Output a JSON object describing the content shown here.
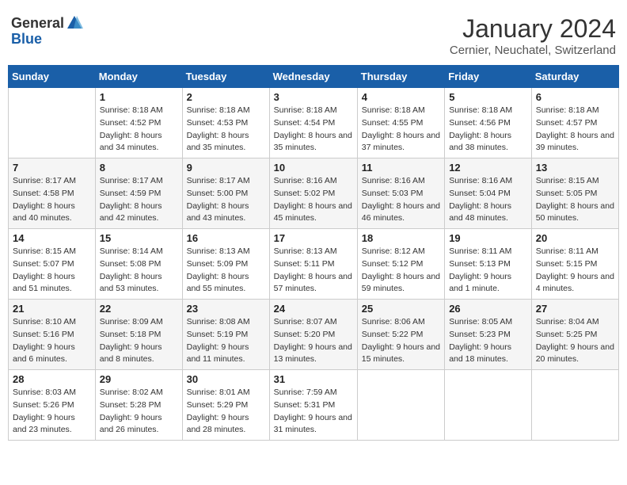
{
  "logo": {
    "general": "General",
    "blue": "Blue"
  },
  "title": "January 2024",
  "location": "Cernier, Neuchatel, Switzerland",
  "header": {
    "days": [
      "Sunday",
      "Monday",
      "Tuesday",
      "Wednesday",
      "Thursday",
      "Friday",
      "Saturday"
    ]
  },
  "weeks": [
    [
      {
        "day": "",
        "sunrise": "",
        "sunset": "",
        "daylight": ""
      },
      {
        "day": "1",
        "sunrise": "Sunrise: 8:18 AM",
        "sunset": "Sunset: 4:52 PM",
        "daylight": "Daylight: 8 hours and 34 minutes."
      },
      {
        "day": "2",
        "sunrise": "Sunrise: 8:18 AM",
        "sunset": "Sunset: 4:53 PM",
        "daylight": "Daylight: 8 hours and 35 minutes."
      },
      {
        "day": "3",
        "sunrise": "Sunrise: 8:18 AM",
        "sunset": "Sunset: 4:54 PM",
        "daylight": "Daylight: 8 hours and 35 minutes."
      },
      {
        "day": "4",
        "sunrise": "Sunrise: 8:18 AM",
        "sunset": "Sunset: 4:55 PM",
        "daylight": "Daylight: 8 hours and 37 minutes."
      },
      {
        "day": "5",
        "sunrise": "Sunrise: 8:18 AM",
        "sunset": "Sunset: 4:56 PM",
        "daylight": "Daylight: 8 hours and 38 minutes."
      },
      {
        "day": "6",
        "sunrise": "Sunrise: 8:18 AM",
        "sunset": "Sunset: 4:57 PM",
        "daylight": "Daylight: 8 hours and 39 minutes."
      }
    ],
    [
      {
        "day": "7",
        "sunrise": "Sunrise: 8:17 AM",
        "sunset": "Sunset: 4:58 PM",
        "daylight": "Daylight: 8 hours and 40 minutes."
      },
      {
        "day": "8",
        "sunrise": "Sunrise: 8:17 AM",
        "sunset": "Sunset: 4:59 PM",
        "daylight": "Daylight: 8 hours and 42 minutes."
      },
      {
        "day": "9",
        "sunrise": "Sunrise: 8:17 AM",
        "sunset": "Sunset: 5:00 PM",
        "daylight": "Daylight: 8 hours and 43 minutes."
      },
      {
        "day": "10",
        "sunrise": "Sunrise: 8:16 AM",
        "sunset": "Sunset: 5:02 PM",
        "daylight": "Daylight: 8 hours and 45 minutes."
      },
      {
        "day": "11",
        "sunrise": "Sunrise: 8:16 AM",
        "sunset": "Sunset: 5:03 PM",
        "daylight": "Daylight: 8 hours and 46 minutes."
      },
      {
        "day": "12",
        "sunrise": "Sunrise: 8:16 AM",
        "sunset": "Sunset: 5:04 PM",
        "daylight": "Daylight: 8 hours and 48 minutes."
      },
      {
        "day": "13",
        "sunrise": "Sunrise: 8:15 AM",
        "sunset": "Sunset: 5:05 PM",
        "daylight": "Daylight: 8 hours and 50 minutes."
      }
    ],
    [
      {
        "day": "14",
        "sunrise": "Sunrise: 8:15 AM",
        "sunset": "Sunset: 5:07 PM",
        "daylight": "Daylight: 8 hours and 51 minutes."
      },
      {
        "day": "15",
        "sunrise": "Sunrise: 8:14 AM",
        "sunset": "Sunset: 5:08 PM",
        "daylight": "Daylight: 8 hours and 53 minutes."
      },
      {
        "day": "16",
        "sunrise": "Sunrise: 8:13 AM",
        "sunset": "Sunset: 5:09 PM",
        "daylight": "Daylight: 8 hours and 55 minutes."
      },
      {
        "day": "17",
        "sunrise": "Sunrise: 8:13 AM",
        "sunset": "Sunset: 5:11 PM",
        "daylight": "Daylight: 8 hours and 57 minutes."
      },
      {
        "day": "18",
        "sunrise": "Sunrise: 8:12 AM",
        "sunset": "Sunset: 5:12 PM",
        "daylight": "Daylight: 8 hours and 59 minutes."
      },
      {
        "day": "19",
        "sunrise": "Sunrise: 8:11 AM",
        "sunset": "Sunset: 5:13 PM",
        "daylight": "Daylight: 9 hours and 1 minute."
      },
      {
        "day": "20",
        "sunrise": "Sunrise: 8:11 AM",
        "sunset": "Sunset: 5:15 PM",
        "daylight": "Daylight: 9 hours and 4 minutes."
      }
    ],
    [
      {
        "day": "21",
        "sunrise": "Sunrise: 8:10 AM",
        "sunset": "Sunset: 5:16 PM",
        "daylight": "Daylight: 9 hours and 6 minutes."
      },
      {
        "day": "22",
        "sunrise": "Sunrise: 8:09 AM",
        "sunset": "Sunset: 5:18 PM",
        "daylight": "Daylight: 9 hours and 8 minutes."
      },
      {
        "day": "23",
        "sunrise": "Sunrise: 8:08 AM",
        "sunset": "Sunset: 5:19 PM",
        "daylight": "Daylight: 9 hours and 11 minutes."
      },
      {
        "day": "24",
        "sunrise": "Sunrise: 8:07 AM",
        "sunset": "Sunset: 5:20 PM",
        "daylight": "Daylight: 9 hours and 13 minutes."
      },
      {
        "day": "25",
        "sunrise": "Sunrise: 8:06 AM",
        "sunset": "Sunset: 5:22 PM",
        "daylight": "Daylight: 9 hours and 15 minutes."
      },
      {
        "day": "26",
        "sunrise": "Sunrise: 8:05 AM",
        "sunset": "Sunset: 5:23 PM",
        "daylight": "Daylight: 9 hours and 18 minutes."
      },
      {
        "day": "27",
        "sunrise": "Sunrise: 8:04 AM",
        "sunset": "Sunset: 5:25 PM",
        "daylight": "Daylight: 9 hours and 20 minutes."
      }
    ],
    [
      {
        "day": "28",
        "sunrise": "Sunrise: 8:03 AM",
        "sunset": "Sunset: 5:26 PM",
        "daylight": "Daylight: 9 hours and 23 minutes."
      },
      {
        "day": "29",
        "sunrise": "Sunrise: 8:02 AM",
        "sunset": "Sunset: 5:28 PM",
        "daylight": "Daylight: 9 hours and 26 minutes."
      },
      {
        "day": "30",
        "sunrise": "Sunrise: 8:01 AM",
        "sunset": "Sunset: 5:29 PM",
        "daylight": "Daylight: 9 hours and 28 minutes."
      },
      {
        "day": "31",
        "sunrise": "Sunrise: 7:59 AM",
        "sunset": "Sunset: 5:31 PM",
        "daylight": "Daylight: 9 hours and 31 minutes."
      },
      {
        "day": "",
        "sunrise": "",
        "sunset": "",
        "daylight": ""
      },
      {
        "day": "",
        "sunrise": "",
        "sunset": "",
        "daylight": ""
      },
      {
        "day": "",
        "sunrise": "",
        "sunset": "",
        "daylight": ""
      }
    ]
  ]
}
